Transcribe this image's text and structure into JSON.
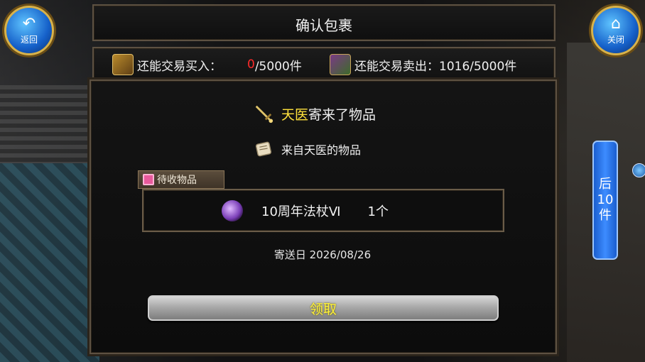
{
  "header": {
    "title": "确认包裹"
  },
  "nav": {
    "back_label": "返回",
    "close_label": "关闭"
  },
  "trade": {
    "buy_label": "还能交易买入：",
    "buy_current": "0",
    "buy_total": "/5000件",
    "sell_label": "还能交易卖出：",
    "sell_value": "1016/5000件"
  },
  "mail": {
    "sender": "天医",
    "sender_suffix": "寄来了物品",
    "subject": "来自天医的物品",
    "pending_label": "待收物品",
    "item_name": "10周年法杖Ⅵ",
    "item_qty": "1个",
    "date_label": "寄送日",
    "date": "2026/08/26",
    "claim_label": "领取"
  },
  "side_tab": {
    "line1": "后",
    "line2": "10",
    "line3": "件"
  },
  "colors": {
    "sender": "#ffe23c",
    "buy_current": "#ff2a2a",
    "claim_text": "#fff23a",
    "tab_blue": "#1a5ecf"
  },
  "icons": {
    "back": "back-arrow-icon",
    "close": "home-icon",
    "buy": "treasure-chest-icon",
    "sell": "sell-shop-icon",
    "sender": "sword-icon",
    "subject": "scroll-icon",
    "pending": "gift-icon",
    "item": "staff-icon"
  }
}
